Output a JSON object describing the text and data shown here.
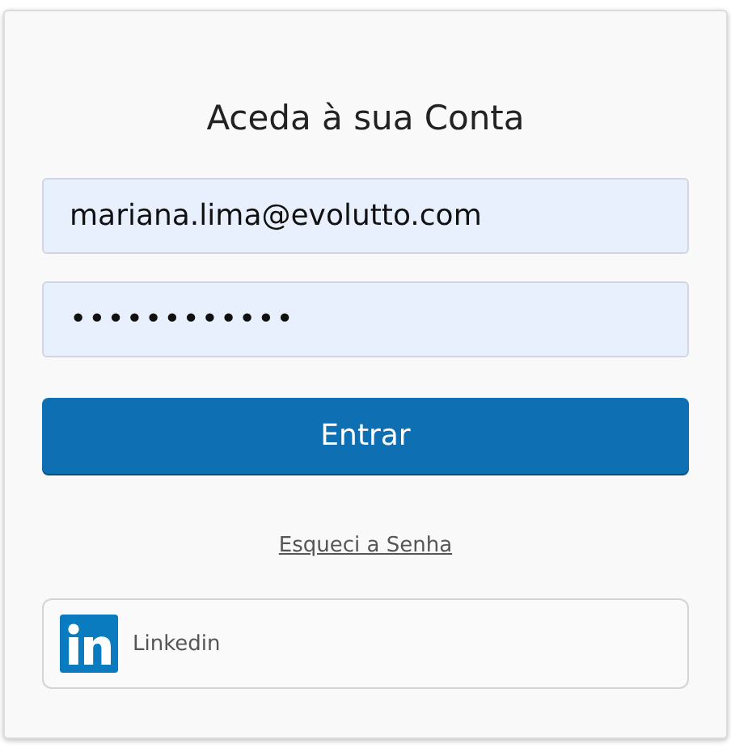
{
  "title": "Aceda à sua Conta",
  "email_field": {
    "value": "mariana.lima@evolutto.com"
  },
  "password_field": {
    "value": "••••••••••••"
  },
  "submit_button": {
    "label": "Entrar"
  },
  "forgot_link": {
    "label": "Esqueci a Senha"
  },
  "social_login": [
    {
      "label": "Linkedin"
    }
  ]
}
